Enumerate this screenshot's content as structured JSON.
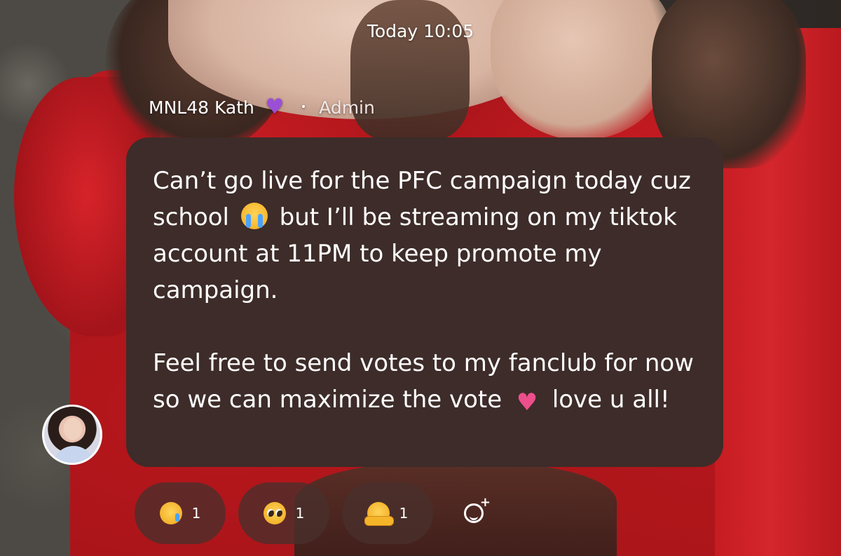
{
  "header": {
    "timestamp": "Today 10:05"
  },
  "message": {
    "sender_name": "MNL48 Kath",
    "sender_badge_icon": "purple-heart-icon",
    "role": "Admin",
    "separator": "•",
    "paragraph1_a": "Can’t go live for the PFC campaign today cuz school",
    "paragraph1_emoji": "loudly-crying-face-emoji",
    "paragraph1_b": "but I’ll be streaming on my tiktok account at 11PM to keep promote my campaign.",
    "paragraph2_a": "Feel free to send votes to my fanclub for now so we can maximize the vote",
    "paragraph2_emoji": "growing-heart-emoji",
    "paragraph2_b": "love u all!",
    "avatar": "sender-avatar"
  },
  "reactions": [
    {
      "icon": "crying-face-emoji",
      "count": "1"
    },
    {
      "icon": "pleading-face-emoji",
      "count": "1"
    },
    {
      "icon": "hugging-face-emoji",
      "count": "1"
    }
  ],
  "add_reaction_icon": "add-reaction-icon",
  "colors": {
    "bubble": "#3d2c29",
    "text": "#ffffff",
    "badge": "#9b4fd6"
  }
}
